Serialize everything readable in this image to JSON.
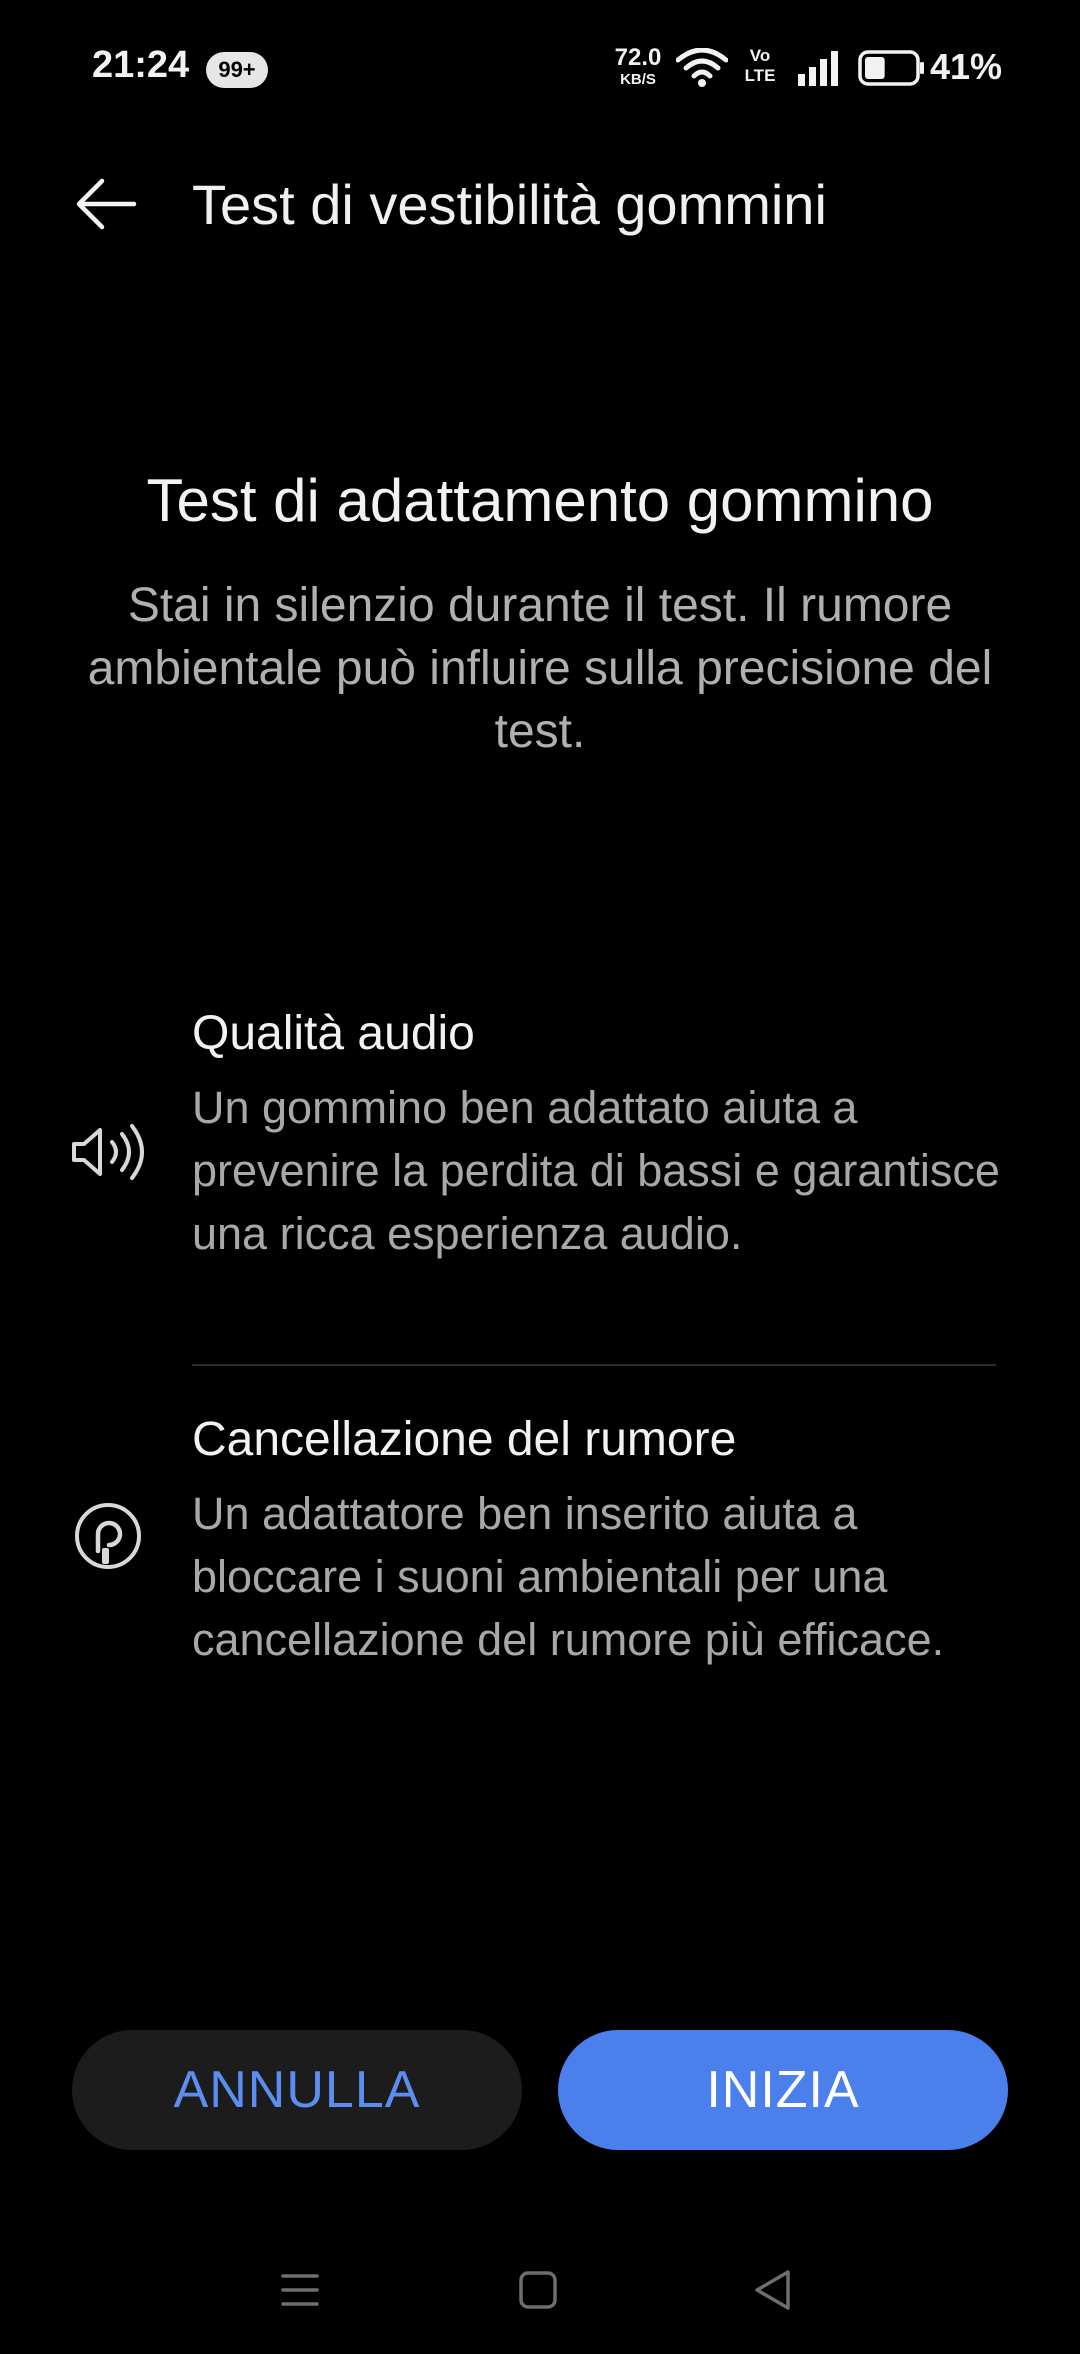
{
  "status_bar": {
    "time": "21:24",
    "notification_badge": "99+",
    "net_speed_value": "72.0",
    "net_speed_unit": "KB/S",
    "volte_top": "Vo",
    "volte_bottom": "LTE",
    "battery_percent": "41%",
    "battery_level": 0.41
  },
  "app_bar": {
    "title": "Test di vestibilità gommini",
    "back_icon": "arrow-left-icon"
  },
  "intro": {
    "title": "Test di adattamento gommino",
    "subtitle": "Stai in silenzio durante il test. Il rumore ambientale può influire sulla precisione del test."
  },
  "features": [
    {
      "icon": "speaker-icon",
      "title": "Qualità audio",
      "description": "Un gommino ben adattato aiuta a prevenire la perdita di bassi e garantisce una ricca esperienza audio."
    },
    {
      "icon": "noise-cancellation-icon",
      "title": "Cancellazione del rumore",
      "description": "Un adattatore ben inserito aiuta a bloccare i suoni ambientali per una cancellazione del rumore più efficace."
    }
  ],
  "buttons": {
    "cancel_label": "ANNULLA",
    "start_label": "INIZIA"
  },
  "colors": {
    "background": "#000000",
    "accent": "#4a7fec",
    "cancel_text": "#5b8ef0"
  }
}
